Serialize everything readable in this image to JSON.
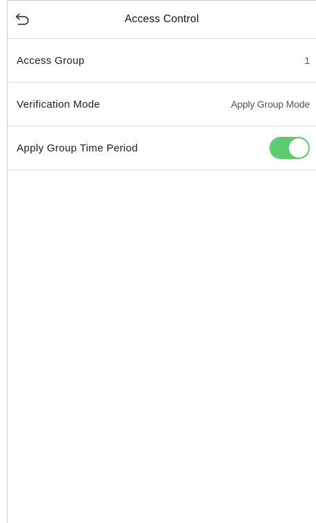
{
  "header": {
    "title": "Access Control",
    "back_icon": "back-arrow-icon"
  },
  "settings": [
    {
      "label": "Access Group",
      "value": "1"
    },
    {
      "label": "Verification Mode",
      "value": "Apply Group Mode"
    },
    {
      "label": "Apply Group Time Period",
      "toggle_on": true
    }
  ],
  "colors": {
    "toggle_on": "#5ccc6f",
    "divider": "#e3e3e3"
  }
}
